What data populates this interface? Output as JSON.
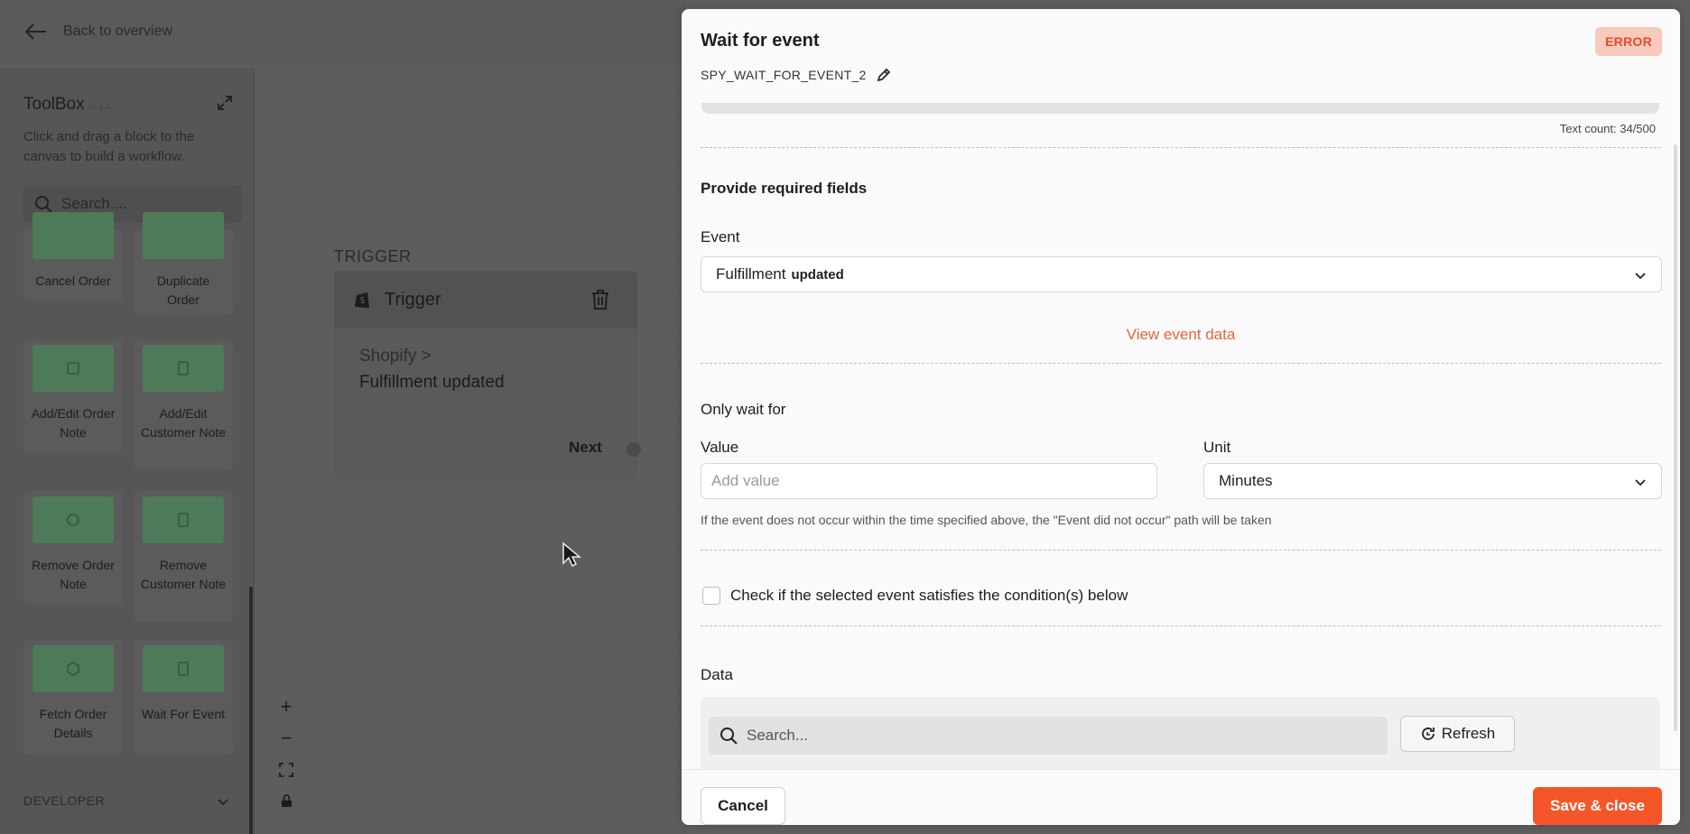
{
  "background": {
    "back_label": "Back to overview",
    "toolbox": {
      "title": "ToolBox",
      "version": "v1.1.2",
      "description": "Click and drag a block to the canvas to build a workflow.",
      "search_placeholder": "Search....",
      "blocks": [
        {
          "label": "Cancel Order",
          "icon": "cancel-order-icon"
        },
        {
          "label": "Duplicate Order",
          "icon": "duplicate-order-icon"
        },
        {
          "label": "Add/Edit Order Note",
          "icon": "order-note-icon"
        },
        {
          "label": "Add/Edit Customer Note",
          "icon": "customer-note-icon"
        },
        {
          "label": "Remove Order Note",
          "icon": "remove-order-note-icon"
        },
        {
          "label": "Remove Customer Note",
          "icon": "remove-customer-note-icon"
        },
        {
          "label": "Fetch Order Details",
          "icon": "fetch-order-icon"
        },
        {
          "label": "Wait For Event",
          "icon": "wait-event-icon"
        }
      ],
      "developer_section": "DEVELOPER"
    },
    "canvas": {
      "section_label": "TRIGGER",
      "trigger_title": "Trigger",
      "source_path": "Shopify >",
      "event_name": "Fulfillment updated",
      "next_label": "Next",
      "zoom_controls": [
        "+",
        "−",
        "⛶",
        "🔒"
      ]
    }
  },
  "panel": {
    "title": "Wait for event",
    "node_id": "SPY_WAIT_FOR_EVENT_2",
    "status_badge": "ERROR",
    "text_count": "Text count: 34/500",
    "section_title": "Provide required fields",
    "event": {
      "label": "Event",
      "value_main": "Fulfillment",
      "value_suffix": "updated"
    },
    "view_event_data": "View event data",
    "only_wait_for": "Only wait for",
    "value_field": {
      "label": "Value",
      "placeholder": "Add value",
      "value": ""
    },
    "unit_field": {
      "label": "Unit",
      "value": "Minutes"
    },
    "hint": "If the event does not occur within the time specified above, the \"Event did not occur\" path will be taken",
    "condition_checkbox": {
      "label": "Check if the selected event satisfies the condition(s) below",
      "checked": false
    },
    "data_section": {
      "title": "Data",
      "search_placeholder": "Search...",
      "refresh_label": "Refresh"
    },
    "footer": {
      "cancel_label": "Cancel",
      "save_label": "Save & close"
    }
  },
  "colors": {
    "accent": "#f4562a",
    "link": "#e8643a",
    "error_bg": "#f8c9bd",
    "error_text": "#e64b24",
    "overlay": "#5e5e5e"
  }
}
